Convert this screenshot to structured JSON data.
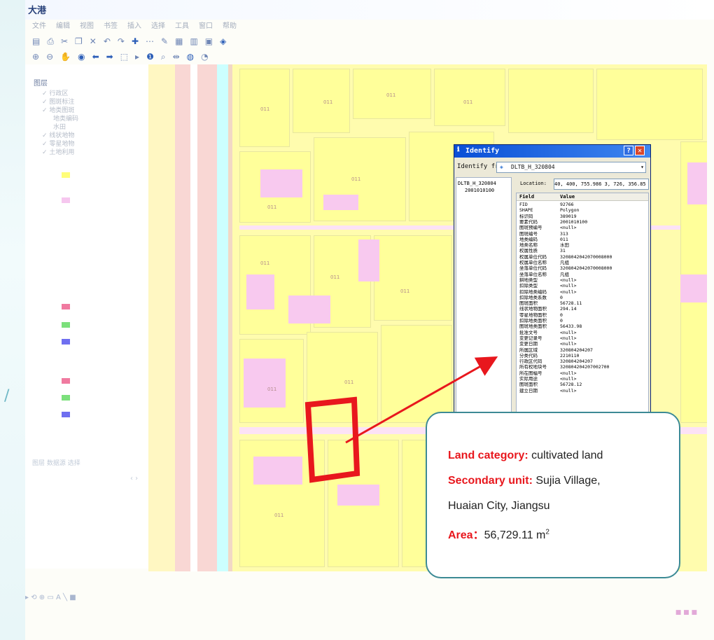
{
  "app": {
    "title_text": "",
    "logo_text": "大港"
  },
  "menu": {
    "items": [
      "文件",
      "编辑",
      "视图",
      "书签",
      "插入",
      "选择",
      "工具",
      "窗口",
      "帮助"
    ]
  },
  "toc": {
    "root_label": "图层",
    "rows": [
      {
        "text": "✓ 行政区",
        "indent": 0
      },
      {
        "text": "✓ 图斑标注",
        "indent": 0
      },
      {
        "text": "✓ 地类图斑",
        "indent": 0
      },
      {
        "text": "地类编码",
        "indent": 1
      },
      {
        "text": "水田",
        "indent": 1
      },
      {
        "text": "✓ 线状地物",
        "indent": 0
      },
      {
        "text": "✓ 零星地物",
        "indent": 0
      },
      {
        "text": "✓ 土地利用",
        "indent": 0
      }
    ],
    "footer_text": "图层  数据源  选择"
  },
  "identify": {
    "title": "Identify",
    "from_label": "Identify from:",
    "from_value": "DLTB_H_320804",
    "tree_root": "DLTB_H_320804",
    "tree_child": "2001010100",
    "location_label": "Location:",
    "location_value": "40, 400, 755.986  3, 726, 356.85",
    "field_header": "Field",
    "value_header": "Value",
    "rows": [
      {
        "f": "FID",
        "v": "92766"
      },
      {
        "f": "SHAPE",
        "v": "Polygon"
      },
      {
        "f": "标识码",
        "v": "389019"
      },
      {
        "f": "要素代码",
        "v": "2001010100"
      },
      {
        "f": "图斑预编号",
        "v": "<null>"
      },
      {
        "f": "图斑编号",
        "v": "313"
      },
      {
        "f": "地类编码",
        "v": "011"
      },
      {
        "f": "地类名称",
        "v": "水田"
      },
      {
        "f": "权属性质",
        "v": "31"
      },
      {
        "f": "权属单位代码",
        "v": "3208042042070008000"
      },
      {
        "f": "权属单位名称",
        "v": "凡组"
      },
      {
        "f": "坐落单位代码",
        "v": "3208042042070008000"
      },
      {
        "f": "坐落单位名称",
        "v": "凡组"
      },
      {
        "f": "耕地类型",
        "v": "<null>"
      },
      {
        "f": "扣除类型",
        "v": "<null>"
      },
      {
        "f": "扣除地类编码",
        "v": "<null>"
      },
      {
        "f": "扣除地类系数",
        "v": "0"
      },
      {
        "f": "图斑面积",
        "v": "56728.11"
      },
      {
        "f": "线状地物面积",
        "v": "294.14"
      },
      {
        "f": "零星地物面积",
        "v": "0"
      },
      {
        "f": "扣除地类面积",
        "v": "0"
      },
      {
        "f": "图斑地类面积",
        "v": "56433.98"
      },
      {
        "f": "批准文号",
        "v": "<null>"
      },
      {
        "f": "变更记录号",
        "v": "<null>"
      },
      {
        "f": "变更日期",
        "v": "<null>"
      },
      {
        "f": "所属区域",
        "v": "320804204207"
      },
      {
        "f": "分类代码",
        "v": "2210110"
      },
      {
        "f": "行政区代码",
        "v": "320804204207"
      },
      {
        "f": "所有权地块号",
        "v": "320804204207002700"
      },
      {
        "f": "所在图幅号",
        "v": "<null>"
      },
      {
        "f": "实际用途",
        "v": "<null>"
      },
      {
        "f": "图斑面积",
        "v": "56728.12"
      },
      {
        "f": "建立日期",
        "v": "<null>"
      }
    ]
  },
  "callout": {
    "land_category_key": "Land category:",
    "land_category_value": " cultivated land",
    "secondary_unit_key": "Secondary unit:",
    "secondary_unit_value": " Sujia Village,",
    "secondary_unit_value_2": "Huaian City, Jiangsu",
    "area_key": "Area",
    "area_sep": "：",
    "area_value": "56,729.11 m",
    "area_unit_sup": "2"
  },
  "map_labels": [
    "011",
    "011",
    "011",
    "011",
    "011",
    "011",
    "011",
    "011",
    "011",
    "011",
    "011",
    "011"
  ],
  "colors": {
    "map_yellow": "#fffcae",
    "parcel_pink": "#f8c9ef",
    "highlight_red": "#e8171d",
    "callout_border": "#3c8a95",
    "dialog_title_blue": "#0a4fd6"
  }
}
